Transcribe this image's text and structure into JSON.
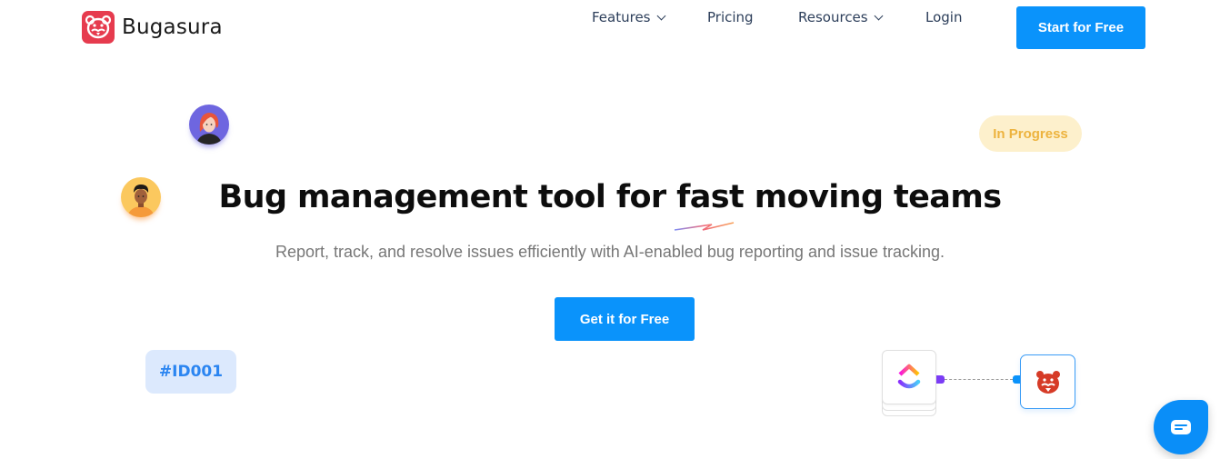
{
  "header": {
    "brand": "Bugasura",
    "nav": [
      {
        "label": "Features",
        "has_dropdown": true
      },
      {
        "label": "Pricing",
        "has_dropdown": false
      },
      {
        "label": "Resources",
        "has_dropdown": true
      },
      {
        "label": "Login",
        "has_dropdown": false
      }
    ],
    "cta_label": "Start for Free"
  },
  "hero": {
    "headline": "Bug management tool for fast moving teams",
    "subtext": "Report, track, and resolve issues efficiently with AI-enabled bug reporting and issue tracking.",
    "cta_label": "Get it for Free"
  },
  "decor": {
    "status_badge": "In Progress",
    "id_badge": "#ID001",
    "integration_from": "clickup-icon",
    "integration_to": "bugasura-icon"
  },
  "colors": {
    "primary": "#0a93fb",
    "brand_red": "#e63b4e",
    "status_yellow": "#edb33e",
    "id_blue": "#2b85f1"
  },
  "chat": {
    "icon": "chat-icon"
  }
}
